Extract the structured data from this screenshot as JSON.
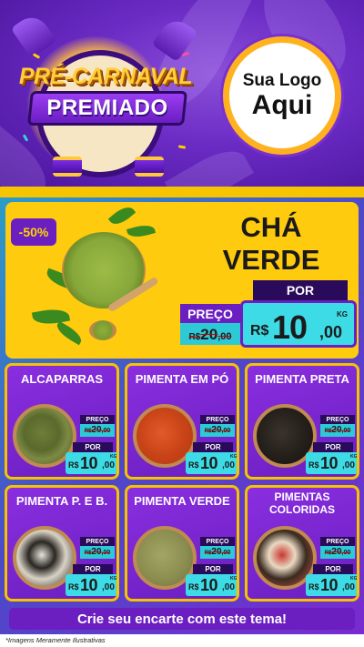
{
  "header": {
    "title_line1": "PRÉ-CARNAVAL",
    "title_line2": "PREMIADO",
    "logo_line1": "Sua Logo",
    "logo_line2": "Aqui"
  },
  "featured": {
    "badge": "-50%",
    "name_line1": "CHÁ",
    "name_line2": "VERDE",
    "preco_label": "PREÇO",
    "old_price": {
      "currency": "R$",
      "int": "20",
      "dec": ",00"
    },
    "por_label": "POR",
    "new_price": {
      "currency": "R$",
      "int": "10",
      "dec": ",00",
      "unit": "KG"
    }
  },
  "cards": [
    {
      "name": "ALCAPARRAS",
      "preco_label": "PREÇO",
      "old_currency": "R$",
      "old_int": "20",
      "old_dec": ",00",
      "por_label": "POR",
      "currency": "R$",
      "int": "10",
      "dec": ",00",
      "unit": "KG"
    },
    {
      "name": "PIMENTA EM PÓ",
      "preco_label": "PREÇO",
      "old_currency": "R$",
      "old_int": "20",
      "old_dec": ",00",
      "por_label": "POR",
      "currency": "R$",
      "int": "10",
      "dec": ",00",
      "unit": "KG"
    },
    {
      "name": "PIMENTA PRETA",
      "preco_label": "PREÇO",
      "old_currency": "R$",
      "old_int": "20",
      "old_dec": ",00",
      "por_label": "POR",
      "currency": "R$",
      "int": "10",
      "dec": ",00",
      "unit": "KG"
    },
    {
      "name": "PIMENTA P. E B.",
      "preco_label": "PREÇO",
      "old_currency": "R$",
      "old_int": "20",
      "old_dec": ",00",
      "por_label": "POR",
      "currency": "R$",
      "int": "10",
      "dec": ",00",
      "unit": "KG"
    },
    {
      "name": "PIMENTA VERDE",
      "preco_label": "PREÇO",
      "old_currency": "R$",
      "old_int": "20",
      "old_dec": ",00",
      "por_label": "POR",
      "currency": "R$",
      "int": "10",
      "dec": ",00",
      "unit": "KG"
    },
    {
      "name": "PIMENTAS COLORIDAS",
      "preco_label": "PREÇO",
      "old_currency": "R$",
      "old_int": "20",
      "old_dec": ",00",
      "por_label": "POR",
      "currency": "R$",
      "int": "10",
      "dec": ",00",
      "unit": "KG"
    }
  ],
  "cta": "Crie seu encarte com este tema!",
  "footnote": "*Imagens Meramente Ilustrativas",
  "colors": {
    "purple": "#6b1fc0",
    "yellow": "#fecb0f",
    "cyan": "#3cdbe6",
    "dark_purple": "#2a0a5a"
  },
  "bowl_contents": [
    "capers",
    "ground-pepper",
    "black-pepper",
    "black-white-pepper",
    "green-pepper",
    "mixed-peppercorns"
  ]
}
